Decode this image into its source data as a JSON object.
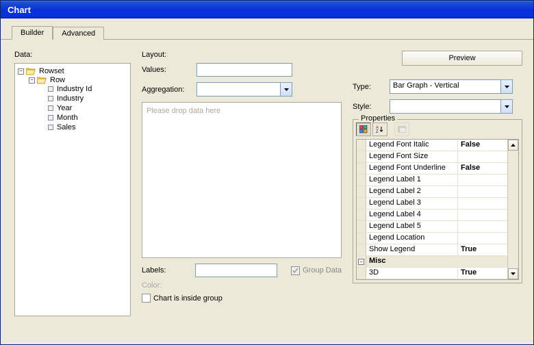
{
  "window": {
    "title": "Chart"
  },
  "tabs": {
    "builder": "Builder",
    "advanced": "Advanced"
  },
  "data": {
    "label": "Data:",
    "tree": {
      "rowset": "Rowset",
      "row": "Row",
      "leaves": [
        "Industry Id",
        "Industry",
        "Year",
        "Month",
        "Sales"
      ]
    }
  },
  "layout": {
    "label": "Layout:",
    "values_label": "Values:",
    "values_value": "",
    "aggregation_label": "Aggregation:",
    "aggregation_value": "",
    "drop_hint": "Please drop data here",
    "labels_label": "Labels:",
    "labels_value": "",
    "group_data_label": "Group Data",
    "color_label": "Color:",
    "inside_group_label": "Chart is inside group"
  },
  "right": {
    "preview": "Preview",
    "type_label": "Type:",
    "type_value": "Bar Graph - Vertical",
    "style_label": "Style:",
    "style_value": ""
  },
  "properties": {
    "legend": "Properties",
    "rows": [
      {
        "name": "Legend Font Italic",
        "value": "False"
      },
      {
        "name": "Legend Font Size",
        "value": ""
      },
      {
        "name": "Legend Font Underline",
        "value": "False"
      },
      {
        "name": "Legend Label 1",
        "value": ""
      },
      {
        "name": "Legend Label 2",
        "value": ""
      },
      {
        "name": "Legend Label 3",
        "value": ""
      },
      {
        "name": "Legend Label 4",
        "value": ""
      },
      {
        "name": "Legend Label 5",
        "value": ""
      },
      {
        "name": "Legend Location",
        "value": ""
      },
      {
        "name": "Show Legend",
        "value": "True"
      }
    ],
    "category": "Misc",
    "cat_rows": [
      {
        "name": "3D",
        "value": "True"
      }
    ]
  }
}
